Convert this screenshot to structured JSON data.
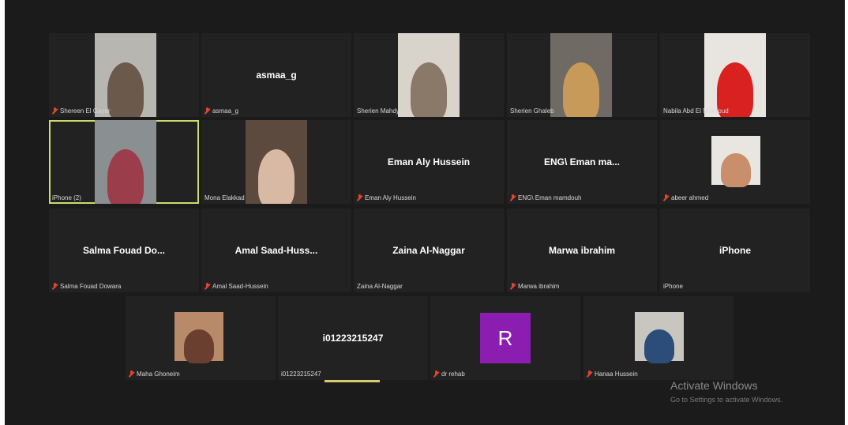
{
  "participants": [
    {
      "name": "Shereen El Gayar",
      "tag": "Shereen El Gayar",
      "muted": true,
      "video": true,
      "colors": [
        "#b8b6b1",
        "#6b5a4b"
      ]
    },
    {
      "name": "asmaa_g",
      "tag": "asmaa_g",
      "muted": true,
      "video": false
    },
    {
      "name": "Sherien Mahdy",
      "tag": "Sherien Mahdy",
      "muted": false,
      "video": true,
      "colors": [
        "#d9d4cb",
        "#8a7868"
      ]
    },
    {
      "name": "Sherien Ghaleb",
      "tag": "Sherien Ghaleb",
      "muted": false,
      "video": true,
      "colors": [
        "#6f6a63",
        "#c79a5a"
      ]
    },
    {
      "name": "Nabila Abd El Maksoud",
      "tag": "Nabila Abd El Maksoud",
      "muted": false,
      "video": true,
      "colors": [
        "#e8e5e0",
        "#d9221f"
      ]
    },
    {
      "name": "iPhone (2)",
      "tag": "iPhone (2)",
      "muted": false,
      "video": true,
      "active": true,
      "colors": [
        "#8a8f92",
        "#9c3d4c"
      ]
    },
    {
      "name": "Mona Elakkad",
      "tag": "Mona Elakkad",
      "muted": false,
      "video": true,
      "colors": [
        "#5d4a3e",
        "#d8b9a4"
      ]
    },
    {
      "name": "Eman  Aly Hussein",
      "tag": "Eman  Aly Hussein",
      "muted": true,
      "video": false
    },
    {
      "name": "ENG\\ Eman ma...",
      "tag": "ENG\\ Eman mamdouh",
      "muted": true,
      "video": false
    },
    {
      "name": "abeer ahmed",
      "tag": "abeer ahmed",
      "muted": true,
      "video": true,
      "colors": [
        "#e9e6e1",
        "#c98f6a"
      ]
    },
    {
      "name": "Salma  Fouad  Do...",
      "tag": "Salma Fouad Dowara",
      "muted": true,
      "video": false
    },
    {
      "name": "Amal  Saad-Huss...",
      "tag": "Amal Saad-Hussein",
      "muted": true,
      "video": false
    },
    {
      "name": "Zaina  Al-Naggar",
      "tag": "Zaina Al-Naggar",
      "muted": false,
      "video": false
    },
    {
      "name": "Marwa  ibrahim",
      "tag": "Marwa ibrahim",
      "muted": true,
      "video": false
    },
    {
      "name": "iPhone",
      "tag": "iPhone",
      "muted": false,
      "video": false
    },
    {
      "name": "Maha Ghoneim",
      "tag": "Maha Ghoneim",
      "muted": true,
      "video": true,
      "colors": [
        "#b98a6a",
        "#6a3f2f"
      ]
    },
    {
      "name": "i01223215247",
      "tag": "i01223215247",
      "muted": false,
      "video": false
    },
    {
      "name": "dr rehab",
      "tag": "dr rehab",
      "muted": true,
      "video": false,
      "avatar": "R",
      "avatar_color": "#8b1db0"
    },
    {
      "name": "Hanaa Hussein",
      "tag": "Hanaa Hussein",
      "muted": true,
      "video": true,
      "colors": [
        "#c9c6c0",
        "#2c4d79"
      ]
    }
  ],
  "watermark": {
    "title": "Activate Windows",
    "subtitle": "Go to Settings to activate Windows."
  }
}
